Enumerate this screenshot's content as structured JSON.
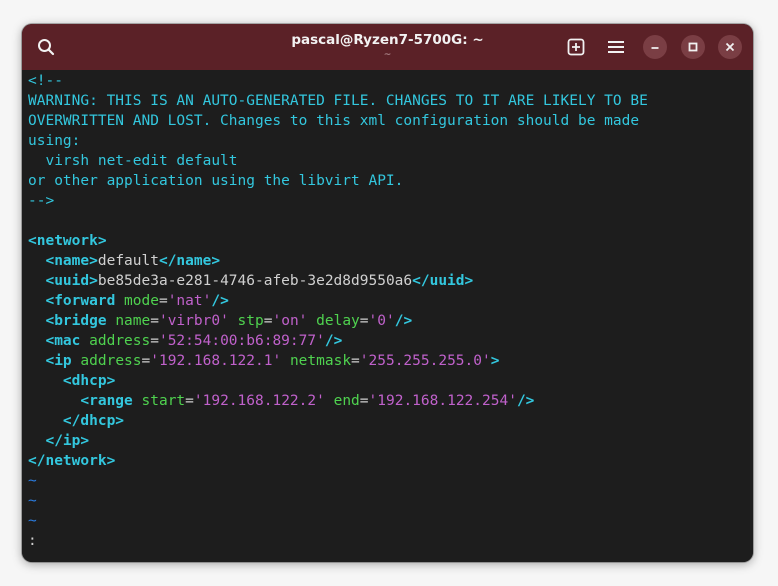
{
  "titlebar": {
    "title": "pascal@Ryzen7-5700G: ~",
    "subtitle": "~",
    "icons": {
      "search": "search-icon",
      "new_tab": "new-tab-icon",
      "menu": "hamburger-menu-icon",
      "minimize": "minimize-icon",
      "maximize": "maximize-icon",
      "close": "close-icon"
    }
  },
  "colors": {
    "titlebar_bg": "#5b2127",
    "terminal_bg": "#1d1d1d",
    "comment": "#33c7de",
    "tag": "#33c7de",
    "attribute": "#4fd24f",
    "value": "#c061cb",
    "text": "#d0d0d0",
    "tilde": "#2a7bde"
  },
  "terminal": {
    "comment": [
      "<!--",
      "WARNING: THIS IS AN AUTO-GENERATED FILE. CHANGES TO IT ARE LIKELY TO BE",
      "OVERWRITTEN AND LOST. Changes to this xml configuration should be made",
      "using:",
      "  virsh net-edit default",
      "or other application using the libvirt API.",
      "-->"
    ],
    "network_open": "<network>",
    "name_open": "<name>",
    "name_value": "default",
    "name_close": "</name>",
    "uuid_open": "<uuid>",
    "uuid_value": "be85de3a-e281-4746-afeb-3e2d8d9550a6",
    "uuid_close": "</uuid>",
    "forward_tag": "<forward",
    "forward_attr": "mode",
    "forward_val": "'nat'",
    "forward_end": "/>",
    "bridge_tag": "<bridge",
    "bridge_name_attr": "name",
    "bridge_name_val": "'virbr0'",
    "bridge_stp_attr": "stp",
    "bridge_stp_val": "'on'",
    "bridge_delay_attr": "delay",
    "bridge_delay_val": "'0'",
    "bridge_end": "/>",
    "mac_tag": "<mac",
    "mac_attr": "address",
    "mac_val": "'52:54:00:b6:89:77'",
    "mac_end": "/>",
    "ip_tag": "<ip",
    "ip_addr_attr": "address",
    "ip_addr_val": "'192.168.122.1'",
    "ip_mask_attr": "netmask",
    "ip_mask_val": "'255.255.255.0'",
    "ip_end": ">",
    "dhcp_open": "<dhcp>",
    "range_tag": "<range",
    "range_start_attr": "start",
    "range_start_val": "'192.168.122.2'",
    "range_end_attr": "end",
    "range_end_val": "'192.168.122.254'",
    "range_end": "/>",
    "dhcp_close": "</dhcp>",
    "ip_close": "</ip>",
    "network_close": "</network>",
    "tilde": "~",
    "prompt": ":"
  }
}
